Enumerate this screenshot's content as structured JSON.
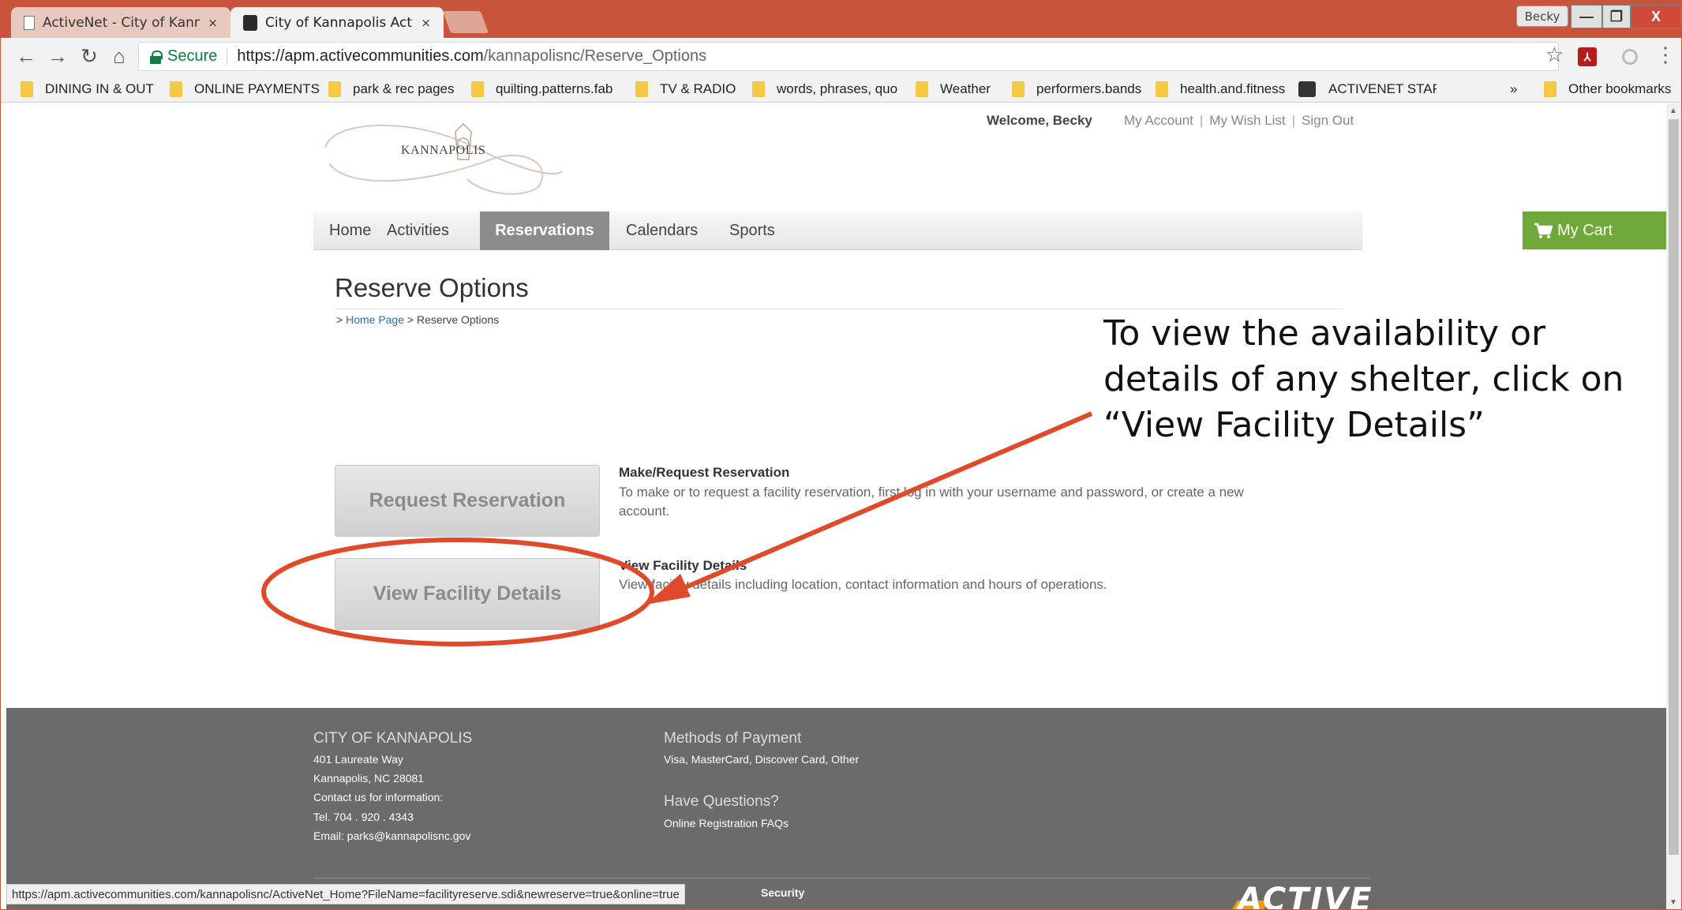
{
  "browser": {
    "tabs": [
      {
        "title": "ActiveNet - City of Kanna",
        "close": "×"
      },
      {
        "title": "City of Kannapolis Activiti",
        "close": "×"
      }
    ],
    "profile_name": "Becky",
    "window_buttons": {
      "minimize": "—",
      "maximize": "❐",
      "close": "X"
    },
    "secure_label": "Secure",
    "url_host": "https://apm.activecommunities.com",
    "url_path": "/kannapolisnc/Reserve_Options",
    "bookmarks": [
      "DINING IN & OUT",
      "ONLINE PAYMENTS",
      "park & rec pages",
      "quilting.patterns.fab",
      "TV & RADIO",
      "words, phrases, quo",
      "Weather",
      "performers.bands",
      "health.and.fitness",
      "ACTIVENET STAFF"
    ],
    "bookmarks_overflow": "»",
    "other_bookmarks": "Other bookmarks",
    "status_url": "https://apm.activecommunities.com/kannapolisnc/ActiveNet_Home?FileName=facilityreserve.sdi&newreserve=true&online=true"
  },
  "site": {
    "logo_text": "KANNAPOLIS",
    "welcome": "Welcome, Becky",
    "account_links": [
      "My Account",
      "My Wish List",
      "Sign Out"
    ],
    "link_separator": "|",
    "nav": [
      "Home",
      "Activities",
      "Reservations",
      "Calendars",
      "Sports"
    ],
    "nav_active": "Reservations",
    "cart_label": "My Cart"
  },
  "main": {
    "heading": "Reserve Options",
    "breadcrumb_prefix": ">",
    "breadcrumb_link": "Home Page",
    "breadcrumb_current": "> Reserve Options",
    "options": [
      {
        "button": "Request Reservation",
        "title": "Make/Request Reservation",
        "description": "To make or to request a facility reservation, first log in with your username and password, or create a new account."
      },
      {
        "button": "View Facility Details",
        "title": "View Facility Details",
        "description": "View facility details including location, contact information and hours of operations."
      }
    ]
  },
  "annotation": {
    "text": "To view the availability or details of any shelter, click on “View Facility Details”",
    "color": "#e04a2a"
  },
  "footer": {
    "city_heading": "CITY OF KANNAPOLIS",
    "address_lines": [
      "401 Laureate Way",
      "Kannapolis, NC 28081",
      "Contact us for information:",
      "Tel. 704 . 920 . 4343",
      "Email: parks@kannapolisnc.gov"
    ],
    "payment_heading": "Methods of Payment",
    "payment_methods": "Visa, MasterCard, Discover Card, Other",
    "questions_heading": "Have Questions?",
    "faq_link": "Online Registration FAQs",
    "security_link": "Security",
    "active_logo": "ACTIVE"
  },
  "colors": {
    "titlebar": "#c8553b",
    "nav_active": "#8c8c8c",
    "cart": "#6fa93a",
    "footer": "#6b6b6b",
    "secure": "#0b8043"
  }
}
